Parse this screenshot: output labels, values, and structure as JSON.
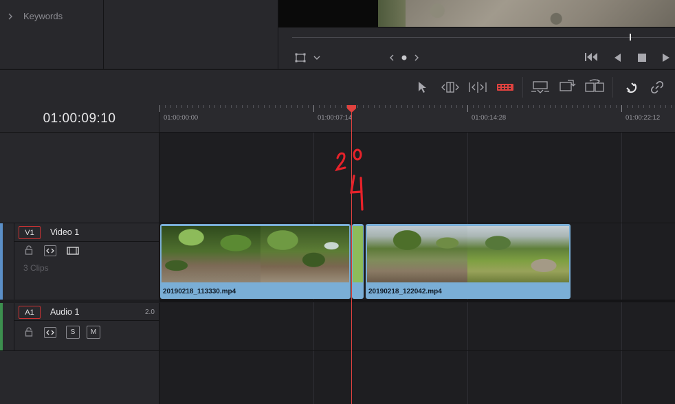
{
  "top_panel": {
    "keywords_label": "Keywords"
  },
  "timecode": "01:00:09:10",
  "ruler": {
    "labels": [
      "01:00:00:00",
      "01:00:07:14",
      "01:00:14:28",
      "01:00:22:12"
    ]
  },
  "tracks": {
    "video": {
      "badge": "V1",
      "name": "Video 1",
      "clip_count": "3 Clips",
      "accent": "#5b8fc7"
    },
    "audio": {
      "badge": "A1",
      "name": "Audio 1",
      "channels": "2.0",
      "solo_label": "S",
      "mute_label": "M",
      "accent": "#3c8f4e"
    }
  },
  "clips": [
    {
      "name": "20190218_113330.mp4"
    },
    {
      "name": ""
    },
    {
      "name": "20190218_122042.mp4"
    }
  ],
  "annotation": {
    "text": "20 4"
  },
  "colors": {
    "playhead": "#e0423f",
    "clip": "#7aaed6",
    "active_tool": "#e0423f"
  }
}
